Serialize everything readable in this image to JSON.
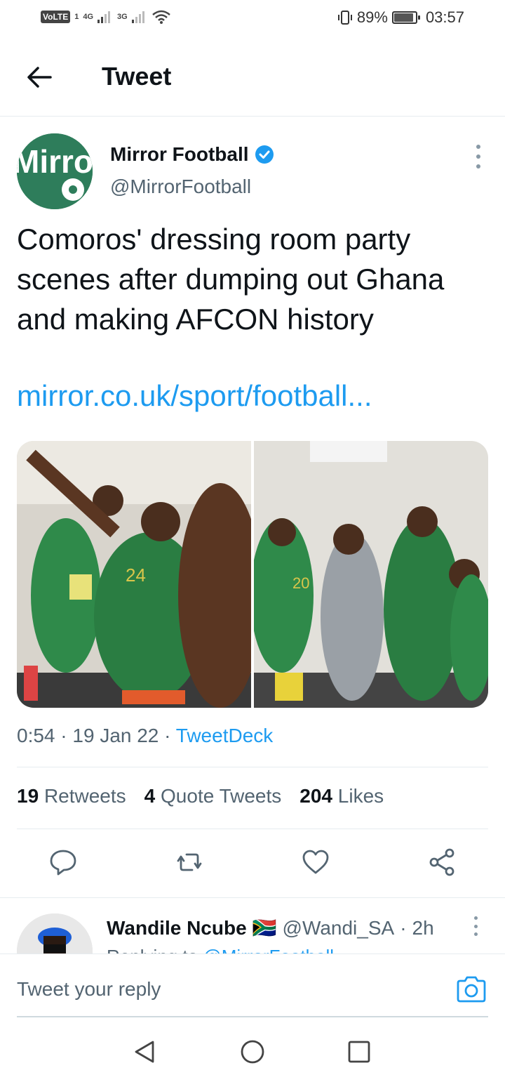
{
  "status_bar": {
    "volte": "VoLTE",
    "sim1": "1",
    "net1": "4G",
    "net2": "3G",
    "battery_pct": "89%",
    "time": "03:57"
  },
  "header": {
    "title": "Tweet"
  },
  "tweet": {
    "author_name": "Mirror Football",
    "avatar_text": "Mirror",
    "handle": "@MirrorFootball",
    "text": "Comoros' dressing room party scenes after dumping out Ghana and making AFCON history",
    "link": "mirror.co.uk/sport/football...",
    "time": "0:54",
    "date": "19 Jan 22",
    "source": "TweetDeck",
    "stats": {
      "retweets_count": "19",
      "retweets_label": "Retweets",
      "quotes_count": "4",
      "quotes_label": "Quote Tweets",
      "likes_count": "204",
      "likes_label": "Likes"
    },
    "jersey_numbers": [
      "24",
      "20"
    ]
  },
  "reply": {
    "name": "Wandile Ncube",
    "flag": "🇿🇦",
    "handle": "@Wandi_SA",
    "age": "2h",
    "replying_prefix": "Replying to",
    "replying_to": "@MirrorFootball"
  },
  "composer": {
    "placeholder": "Tweet your reply"
  },
  "colors": {
    "accent": "#1d9bf0",
    "text": "#0f1419",
    "muted": "#536471"
  }
}
